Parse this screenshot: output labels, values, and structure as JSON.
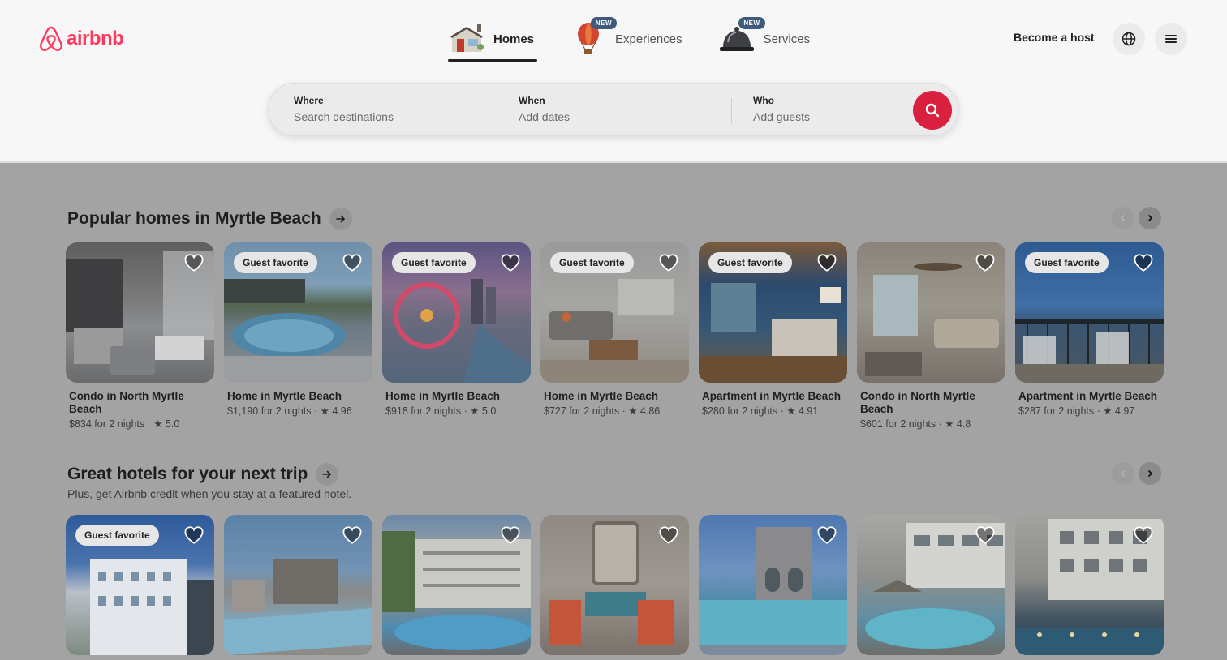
{
  "brand": {
    "name": "airbnb",
    "color": "#ff385c"
  },
  "nav": {
    "tabs": [
      {
        "label": "Homes",
        "icon": "house-icon",
        "active": true,
        "badge": ""
      },
      {
        "label": "Experiences",
        "icon": "hot-air-balloon-icon",
        "active": false,
        "badge": "NEW"
      },
      {
        "label": "Services",
        "icon": "service-bell-icon",
        "active": false,
        "badge": "NEW"
      }
    ],
    "host_label": "Become a host"
  },
  "search": {
    "where": {
      "label": "Where",
      "placeholder": "Search destinations"
    },
    "when": {
      "label": "When",
      "placeholder": "Add dates"
    },
    "who": {
      "label": "Who",
      "placeholder": "Add guests"
    }
  },
  "sections": [
    {
      "title": "Popular homes in Myrtle Beach",
      "subtitle": "",
      "listings": [
        {
          "badge": "",
          "title": "Condo in North Myrtle Beach",
          "price": "$834 for 2 nights",
          "rating": "5.0"
        },
        {
          "badge": "Guest favorite",
          "title": "Home in Myrtle Beach",
          "price": "$1,190 for 2 nights",
          "rating": "4.96"
        },
        {
          "badge": "Guest favorite",
          "title": "Home in Myrtle Beach",
          "price": "$918 for 2 nights",
          "rating": "5.0"
        },
        {
          "badge": "Guest favorite",
          "title": "Home in Myrtle Beach",
          "price": "$727 for 2 nights",
          "rating": "4.86"
        },
        {
          "badge": "Guest favorite",
          "title": "Apartment in Myrtle Beach",
          "price": "$280 for 2 nights",
          "rating": "4.91"
        },
        {
          "badge": "",
          "title": "Condo in North Myrtle Beach",
          "price": "$601 for 2 nights",
          "rating": "4.8"
        },
        {
          "badge": "Guest favorite",
          "title": "Apartment in Myrtle Beach",
          "price": "$287 for 2 nights",
          "rating": "4.97"
        }
      ]
    },
    {
      "title": "Great hotels for your next trip",
      "subtitle": "Plus, get Airbnb credit when you stay at a featured hotel.",
      "listings": [
        {
          "badge": "Guest favorite"
        },
        {
          "badge": ""
        },
        {
          "badge": ""
        },
        {
          "badge": ""
        },
        {
          "badge": ""
        },
        {
          "badge": ""
        },
        {
          "badge": ""
        }
      ]
    }
  ]
}
